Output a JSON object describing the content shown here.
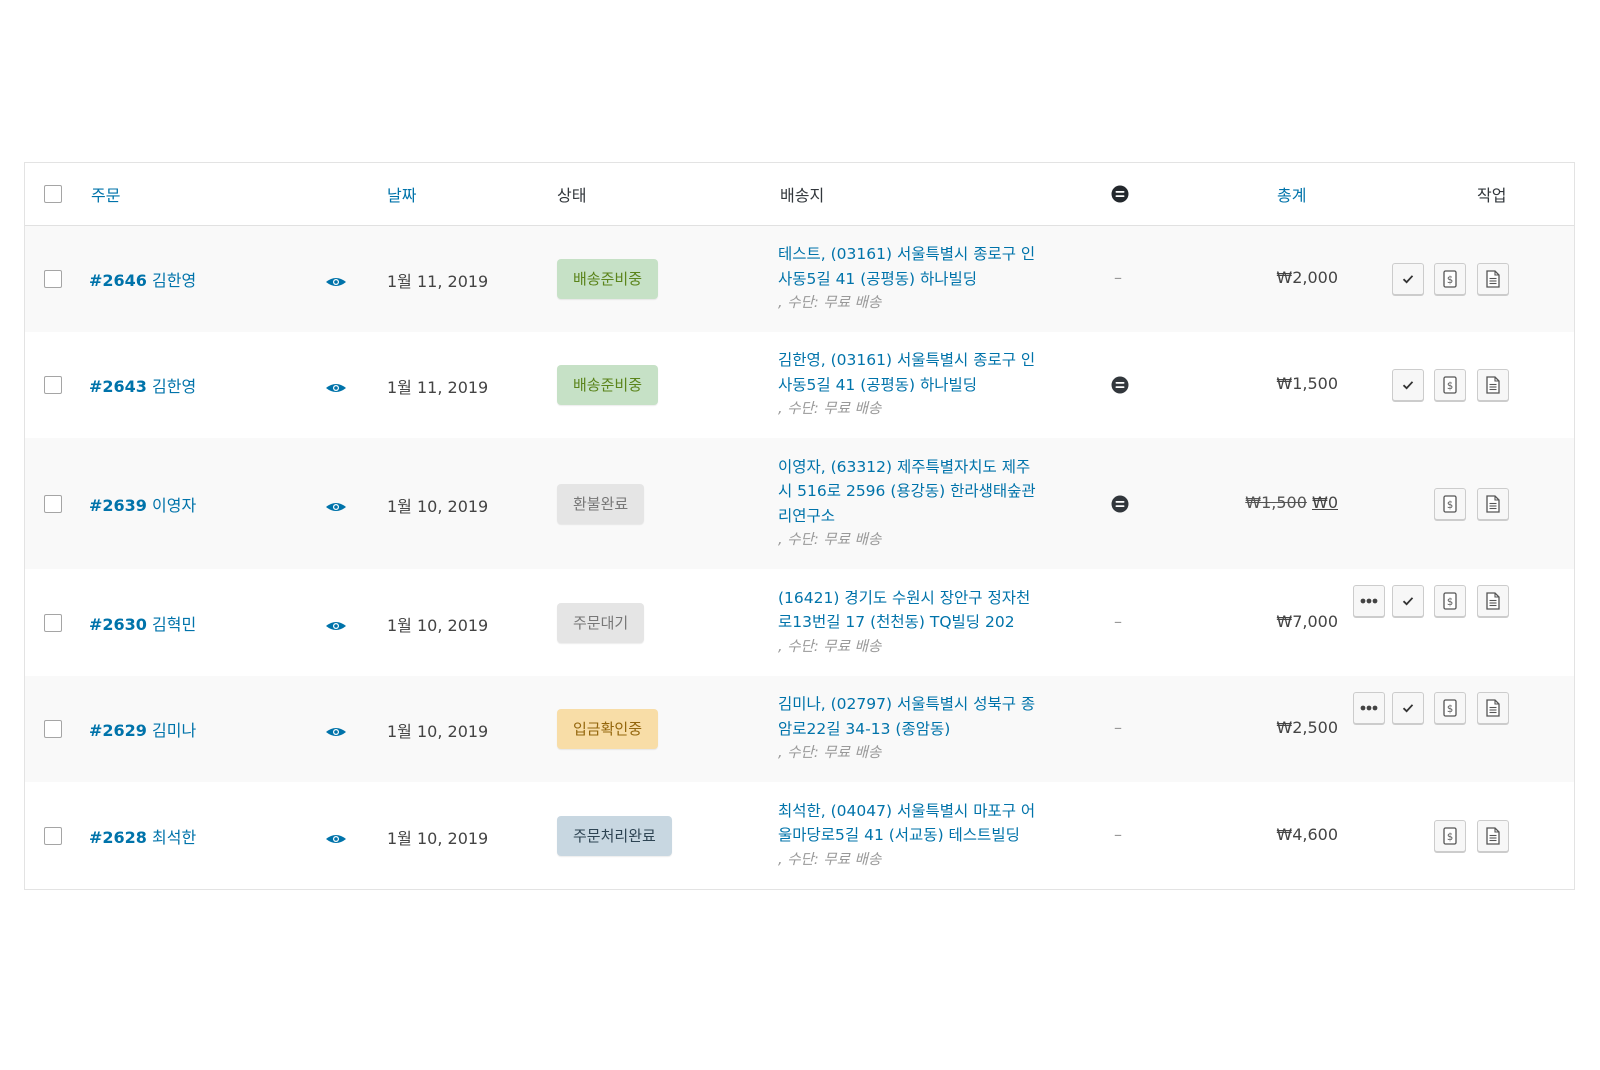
{
  "header": {
    "order": "주문",
    "date": "날짜",
    "status": "상태",
    "shipping": "배송지",
    "total": "총계",
    "actions": "작업"
  },
  "colors": {
    "link": "#0073aa",
    "processing_bg": "#c6e1c6",
    "processing_fg": "#5b841b",
    "refunded_bg": "#e5e5e5",
    "refunded_fg": "#777777",
    "pending_bg": "#e5e5e5",
    "pending_fg": "#777777",
    "on_hold_bg": "#f8dda7",
    "on_hold_fg": "#94660c",
    "completed_bg": "#c8d7e1",
    "completed_fg": "#2e4453"
  },
  "orders": [
    {
      "number": "#2646",
      "customer": "김한영",
      "date": "1월 11, 2019",
      "status": "배송준비중",
      "status_type": "processing",
      "address_lines": [
        "테스트, (03161) 서울특별시 종로구 인",
        "사동5길 41 (공평동) 하나빌딩"
      ],
      "method": ", 수단: 무료 배송",
      "note": "–",
      "has_note_icon": false,
      "total": "₩2,000",
      "total_old": "",
      "actions": [
        "complete",
        "invoice",
        "packing-slip"
      ]
    },
    {
      "number": "#2643",
      "customer": "김한영",
      "date": "1월 11, 2019",
      "status": "배송준비중",
      "status_type": "processing",
      "address_lines": [
        "김한영, (03161) 서울특별시 종로구 인",
        "사동5길 41 (공평동) 하나빌딩"
      ],
      "method": ", 수단: 무료 배송",
      "note": "",
      "has_note_icon": true,
      "total": "₩1,500",
      "total_old": "",
      "actions": [
        "complete",
        "invoice",
        "packing-slip"
      ]
    },
    {
      "number": "#2639",
      "customer": "이영자",
      "date": "1월 10, 2019",
      "status": "환불완료",
      "status_type": "refunded",
      "address_lines": [
        "이영자, (63312) 제주특별자치도 제주",
        "시 516로 2596 (용강동) 한라생태숲관",
        "리연구소"
      ],
      "method": ", 수단: 무료 배송",
      "note": "",
      "has_note_icon": true,
      "total": "₩0",
      "total_old": "₩1,500",
      "actions": [
        "invoice",
        "packing-slip"
      ]
    },
    {
      "number": "#2630",
      "customer": "김혁민",
      "date": "1월 10, 2019",
      "status": "주문대기",
      "status_type": "pending",
      "address_lines": [
        "(16421) 경기도 수원시 장안구 정자천",
        "로13번길 17 (천천동) TQ빌딩 202"
      ],
      "method": ", 수단: 무료 배송",
      "note": "–",
      "has_note_icon": false,
      "total": "₩7,000",
      "total_old": "",
      "actions": [
        "processing",
        "complete",
        "invoice",
        "packing-slip"
      ]
    },
    {
      "number": "#2629",
      "customer": "김미나",
      "date": "1월 10, 2019",
      "status": "입금확인중",
      "status_type": "on_hold",
      "address_lines": [
        "김미나, (02797) 서울특별시 성북구 종",
        "암로22길 34-13 (종암동)"
      ],
      "method": ", 수단: 무료 배송",
      "note": "–",
      "has_note_icon": false,
      "total": "₩2,500",
      "total_old": "",
      "actions": [
        "processing",
        "complete",
        "invoice",
        "packing-slip"
      ]
    },
    {
      "number": "#2628",
      "customer": "최석한",
      "date": "1월 10, 2019",
      "status": "주문처리완료",
      "status_type": "completed",
      "address_lines": [
        "최석한, (04047) 서울특별시 마포구 어",
        "울마당로5길 41 (서교동) 테스트빌딩"
      ],
      "method": ", 수단: 무료 배송",
      "note": "–",
      "has_note_icon": false,
      "total": "₩4,600",
      "total_old": "",
      "actions": [
        "invoice",
        "packing-slip"
      ]
    }
  ]
}
